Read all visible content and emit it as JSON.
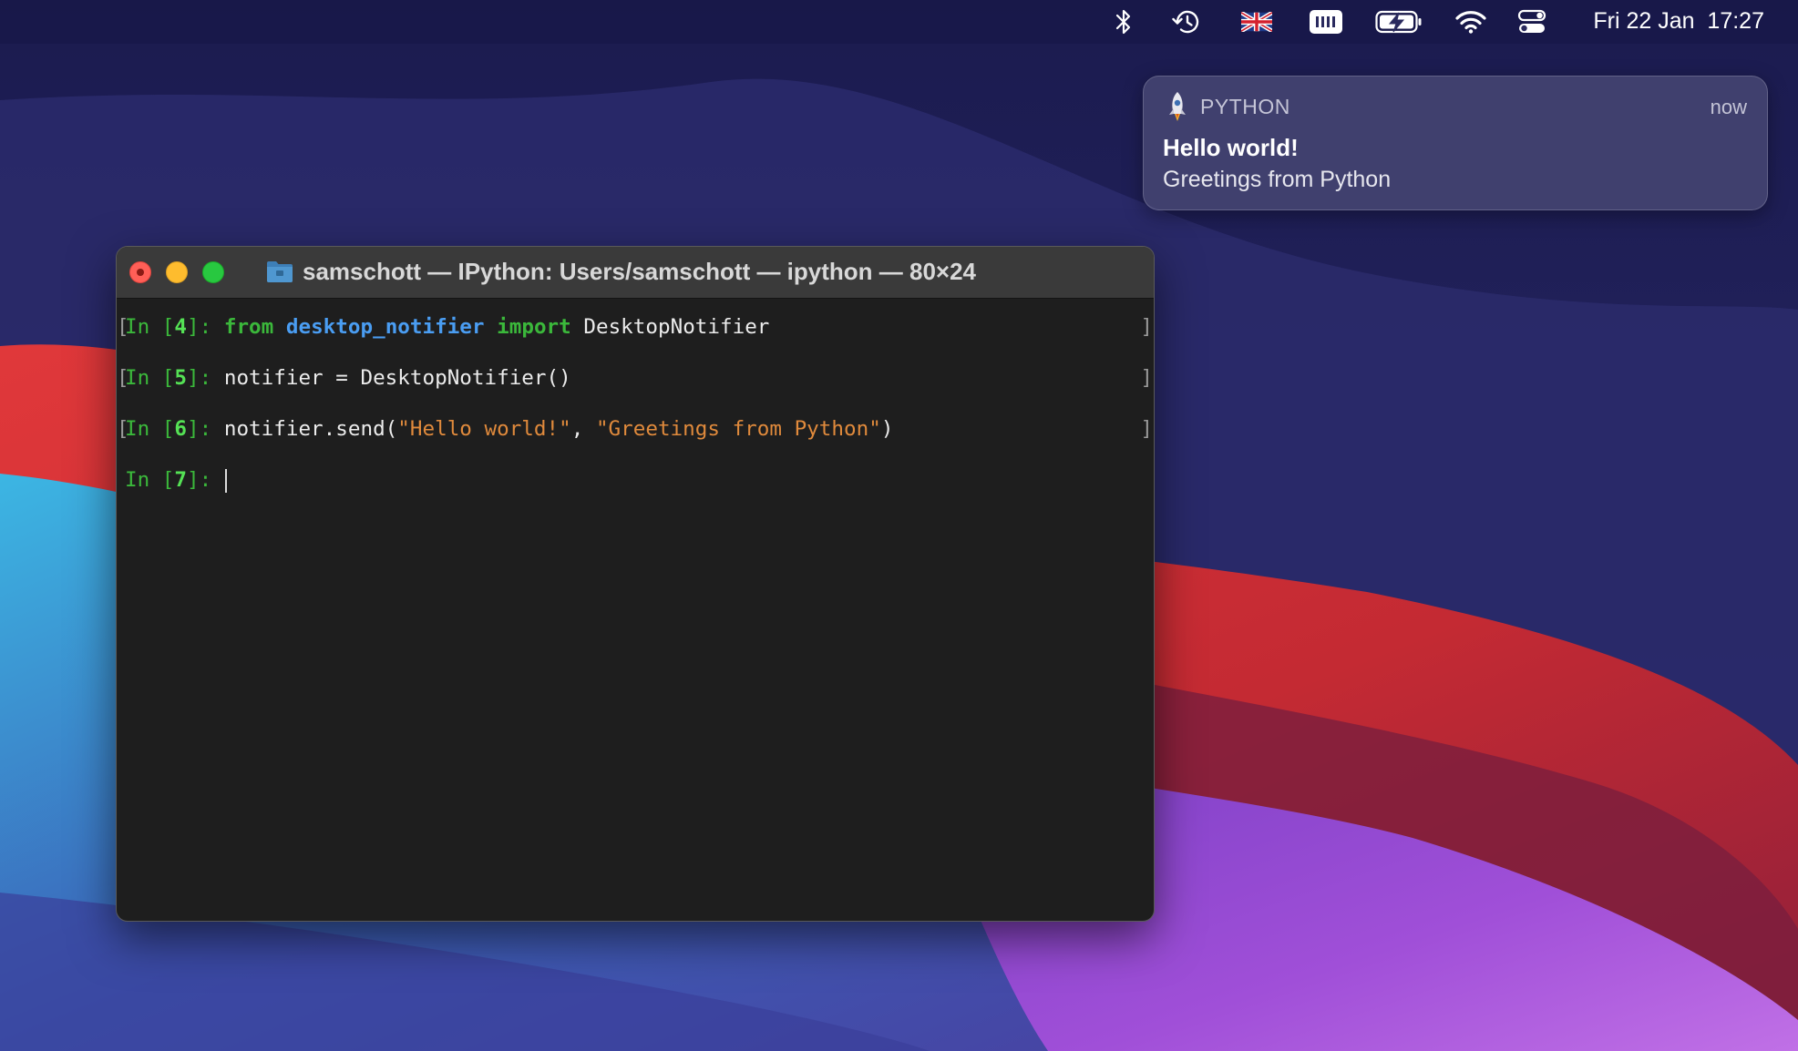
{
  "menubar": {
    "icons": [
      "bluetooth-icon",
      "time-machine-icon",
      "uk-flag-icon",
      "keyboard-input-icon",
      "battery-charging-icon",
      "wifi-icon",
      "control-center-icon"
    ],
    "clock": "Fri 22 Jan  17:27"
  },
  "notification": {
    "app_icon": "python-rocket-icon",
    "app_name": "PYTHON",
    "time": "now",
    "title": "Hello world!",
    "body": "Greetings from Python"
  },
  "terminal": {
    "title": "samschott — IPython: Users/samschott — ipython — 80×24",
    "lines": [
      {
        "prompt_in": "In [",
        "prompt_num": "4",
        "prompt_end": "]: ",
        "tokens": [
          {
            "text": "from",
            "kind": "kw"
          },
          {
            "text": " ",
            "kind": "plain"
          },
          {
            "text": "desktop_notifier",
            "kind": "mod"
          },
          {
            "text": " ",
            "kind": "plain"
          },
          {
            "text": "import",
            "kind": "kw"
          },
          {
            "text": " DesktopNotifier",
            "kind": "plain"
          }
        ]
      },
      {
        "prompt_in": "In [",
        "prompt_num": "5",
        "prompt_end": "]: ",
        "tokens": [
          {
            "text": "notifier = DesktopNotifier()",
            "kind": "plain"
          }
        ]
      },
      {
        "prompt_in": "In [",
        "prompt_num": "6",
        "prompt_end": "]: ",
        "tokens": [
          {
            "text": "notifier.send(",
            "kind": "plain"
          },
          {
            "text": "\"Hello world!\"",
            "kind": "str"
          },
          {
            "text": ", ",
            "kind": "plain"
          },
          {
            "text": "\"Greetings from Python\"",
            "kind": "str"
          },
          {
            "text": ")",
            "kind": "plain"
          }
        ]
      }
    ],
    "current_prompt": {
      "prompt_in": "In [",
      "prompt_num": "7",
      "prompt_end": "]: "
    }
  },
  "colors": {
    "prompt": "#3bb83b",
    "prompt_number": "#55e255",
    "keyword": "#3bb83b",
    "module": "#4a9df2",
    "string": "#e08a3c",
    "terminal_bg": "#1e1e1e"
  }
}
